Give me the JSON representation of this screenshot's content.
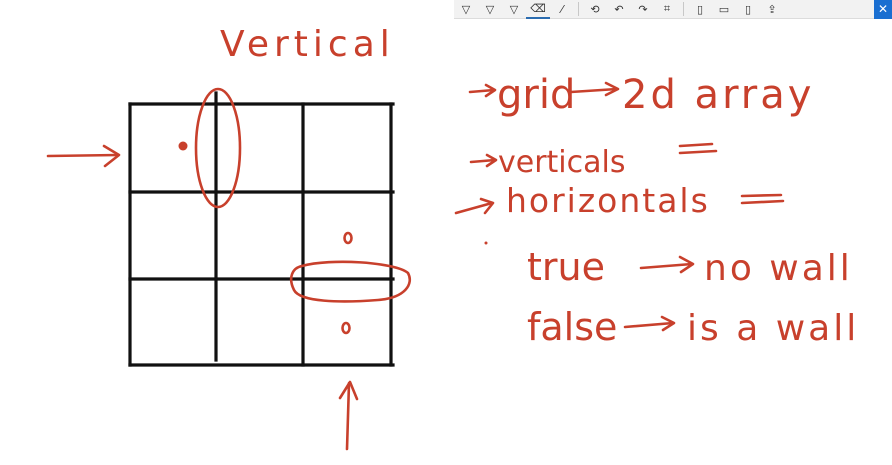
{
  "toolbar": {
    "items": [
      {
        "icon": "pen-icon",
        "glyph": "▽"
      },
      {
        "icon": "pen-icon-2",
        "glyph": "▽"
      },
      {
        "icon": "highlighter-icon",
        "glyph": "▽"
      },
      {
        "icon": "eraser-icon",
        "glyph": "⌫"
      },
      {
        "icon": "ruler-icon",
        "glyph": "⁄"
      },
      {
        "icon": "lasso-icon",
        "glyph": "⟲"
      },
      {
        "icon": "undo-icon",
        "glyph": "↶"
      },
      {
        "icon": "redo-icon",
        "glyph": "↷"
      },
      {
        "icon": "crop-icon",
        "glyph": "⌗"
      },
      {
        "icon": "copy-icon",
        "glyph": "▯"
      },
      {
        "icon": "save-icon",
        "glyph": "▭"
      },
      {
        "icon": "save-as-icon",
        "glyph": "▯"
      },
      {
        "icon": "share-icon",
        "glyph": "⇪"
      }
    ],
    "close_glyph": "✕"
  },
  "notes": {
    "vertical": "Vertical",
    "grid": "grid",
    "grid_value": "2d array",
    "verticals": "verticals",
    "horizontals": "horizontals",
    "true_text": "true",
    "true_value": "no wall",
    "false_text": "false",
    "false_value": "is a wall"
  },
  "colors": {
    "ink": "#c8402c",
    "grid": "#111111",
    "accent": "#1a6fd1"
  }
}
